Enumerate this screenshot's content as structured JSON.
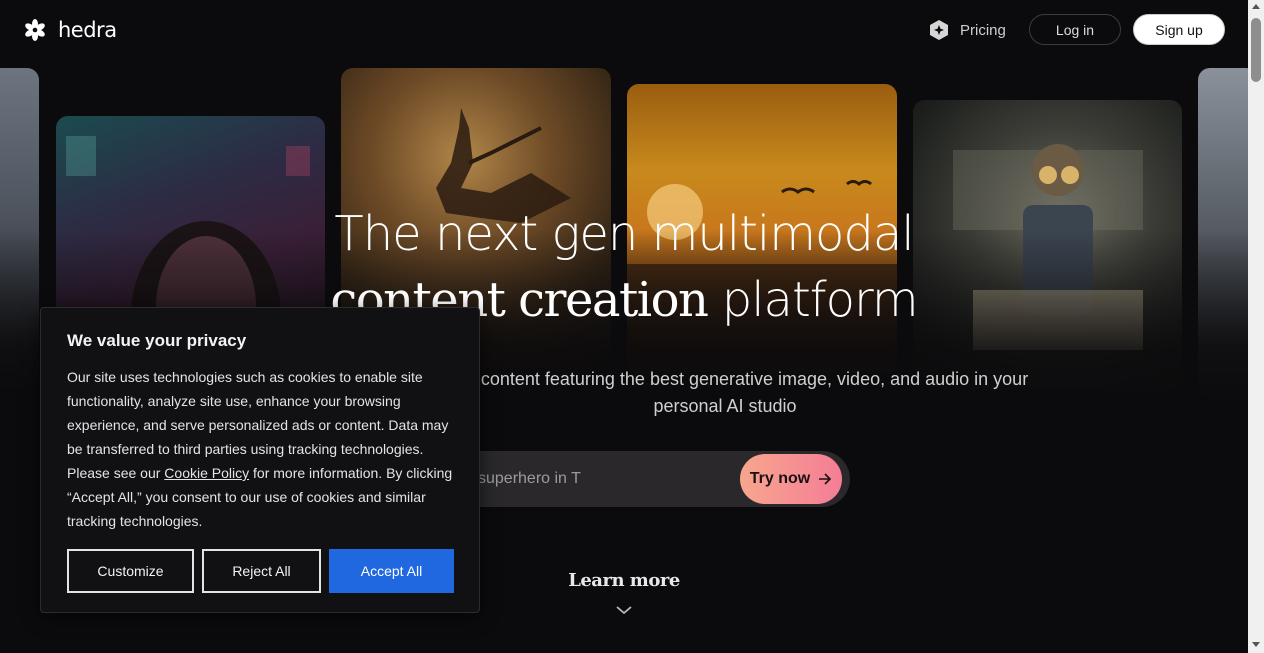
{
  "header": {
    "logo_text": "hedra",
    "logo_icon": "hedra-flower-logo",
    "pricing_label": "Pricing",
    "pricing_icon": "hexagon-sparkle-icon",
    "login_label": "Log in",
    "signup_label": "Sign up"
  },
  "hero": {
    "title_line1": "The next gen multimodal",
    "title_line2_serif": "content creation",
    "title_line2_sans": " platform",
    "subtitle": "Create content featuring the best generative image, video, and audio in your personal AI studio",
    "prompt_placeholder": "superhero in T",
    "try_button_label": "Try now",
    "try_button_icon": "arrow-right-icon",
    "learn_more_label": "Learn more",
    "learn_more_icon": "chevron-down-icon"
  },
  "gallery": {
    "cards": [
      "snowy-landscape-edge",
      "woman-neon-portrait",
      "ballet-dancer",
      "sunset-birds",
      "boy-with-goggles",
      "snowy-landscape-edge"
    ]
  },
  "cookie_banner": {
    "title": "We value your privacy",
    "body_before_link": "Our site uses technologies such as cookies to enable site functionality, analyze site use, enhance your browsing experience, and serve personalized ads or content. Data may be transferred to third parties using tracking technologies. Please see our ",
    "link_text": "Cookie Policy",
    "body_after_link": " for more information. By clicking “Accept All,” you consent to our use of cookies and similar tracking technologies.",
    "customize_label": "Customize",
    "reject_label": "Reject All",
    "accept_label": "Accept All"
  },
  "colors": {
    "background": "#0b0a0c",
    "accept_blue": "#1f68e0",
    "try_gradient_start": "#f7a68e",
    "try_gradient_end": "#f47d96"
  }
}
